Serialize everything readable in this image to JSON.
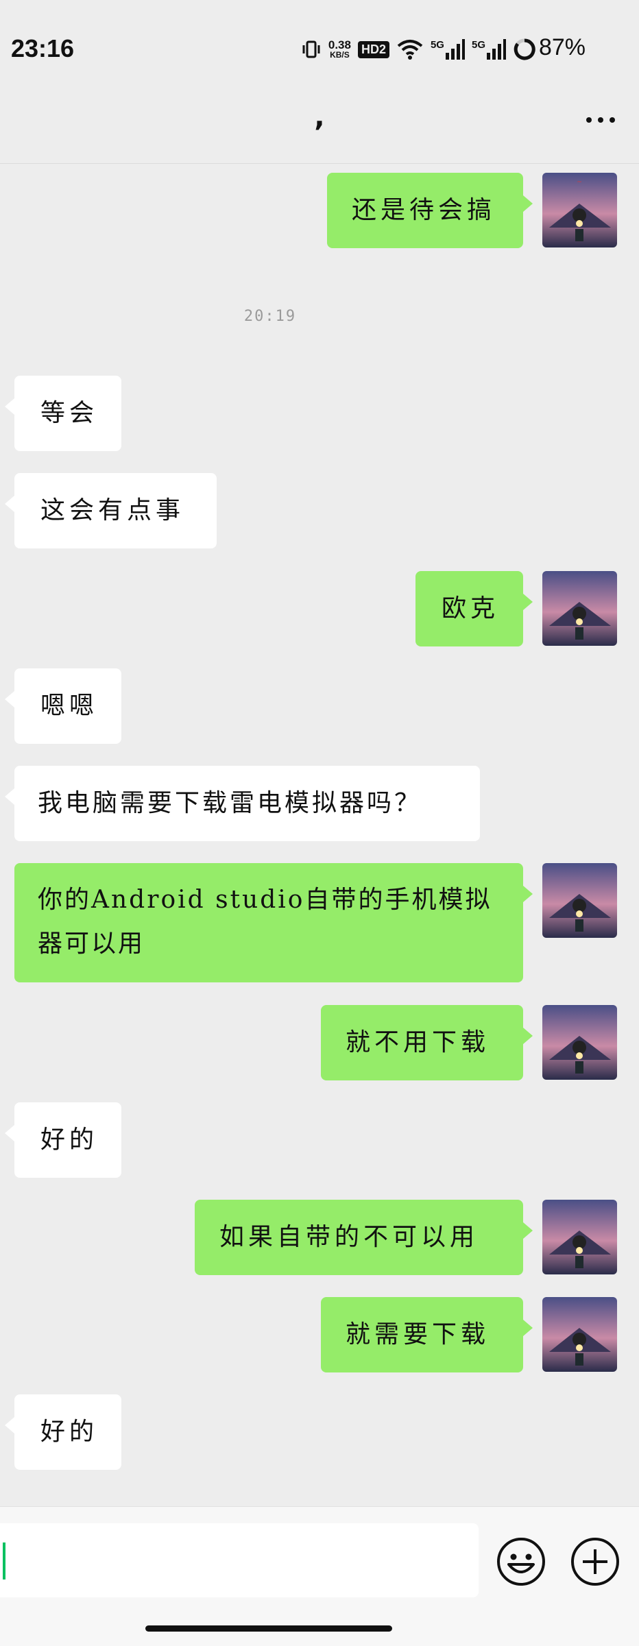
{
  "status_bar": {
    "time": "23:16",
    "net_speed_value": "0.38",
    "net_speed_unit": "KB/S",
    "hd_badge": "HD2",
    "sim1_label": "5G",
    "sim2_label": "5G",
    "battery_percent": "87%"
  },
  "header": {
    "title": ",",
    "more_icon": "more-horizontal-icon"
  },
  "timestamp": "20:19",
  "messages": [
    {
      "side": "out",
      "lines": [
        "还是待会搞"
      ]
    },
    {
      "side": "in",
      "lines": [
        "等会"
      ]
    },
    {
      "side": "in",
      "lines": [
        "这会有点事"
      ]
    },
    {
      "side": "out",
      "lines": [
        "欧克"
      ]
    },
    {
      "side": "in",
      "lines": [
        "嗯嗯"
      ]
    },
    {
      "side": "in",
      "lines": [
        "我电脑需要下载雷电模拟器吗？"
      ]
    },
    {
      "side": "out",
      "lines": [
        "你的Android studio自带的手机模拟",
        "器可以用"
      ]
    },
    {
      "side": "out",
      "lines": [
        "就不用下载"
      ]
    },
    {
      "side": "in",
      "lines": [
        "好的"
      ]
    },
    {
      "side": "out",
      "lines": [
        "如果自带的不可以用"
      ]
    },
    {
      "side": "out",
      "lines": [
        "就需要下载"
      ]
    },
    {
      "side": "in",
      "lines": [
        "好的"
      ]
    }
  ],
  "input_bar": {
    "input_value": "",
    "emoji_icon": "smiley-icon",
    "add_icon": "plus-circle-icon"
  },
  "colors": {
    "background": "#ededed",
    "outgoing_bubble": "#95ec69",
    "incoming_bubble": "#ffffff",
    "cursor": "#07c160"
  }
}
